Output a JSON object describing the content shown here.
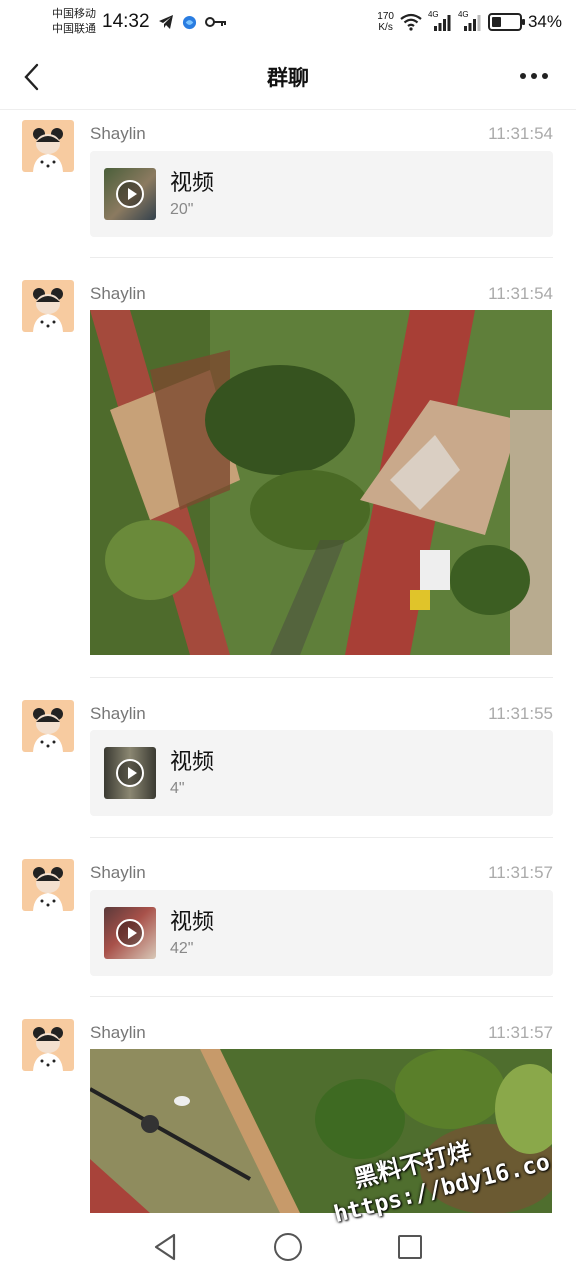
{
  "status_bar": {
    "carrier_1": "中国移动",
    "carrier_2": "中国联通",
    "time": "14:32",
    "net_speed_value": "170",
    "net_speed_unit": "K/s",
    "signal_1_label": "4G",
    "signal_2_label": "4G",
    "battery_level": 0.34,
    "battery_percent": "34%"
  },
  "header": {
    "title": "群聊"
  },
  "messages": [
    {
      "sender": "Shaylin",
      "time": "11:31:54",
      "type": "video",
      "title": "视频",
      "duration": "20\""
    },
    {
      "sender": "Shaylin",
      "time": "11:31:54",
      "type": "image"
    },
    {
      "sender": "Shaylin",
      "time": "11:31:55",
      "type": "video",
      "title": "视频",
      "duration": "4\""
    },
    {
      "sender": "Shaylin",
      "time": "11:31:57",
      "type": "video",
      "title": "视频",
      "duration": "42\""
    },
    {
      "sender": "Shaylin",
      "time": "11:31:57",
      "type": "image"
    }
  ],
  "watermark": {
    "line_1": "黑料不打烊",
    "line_2": "https://bdy16.co"
  },
  "colors": {
    "avatar_bg": "#f7cba0",
    "card_bg": "#f4f4f4",
    "timestamp": "#aaaaaa",
    "sender": "#777777"
  }
}
